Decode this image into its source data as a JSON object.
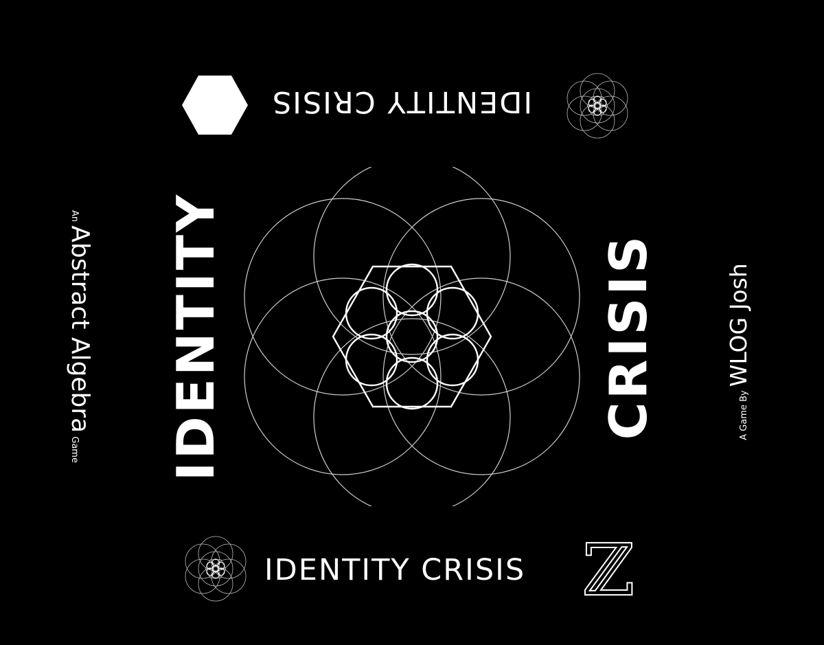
{
  "box": {
    "title_top": "IDENTITY CRISIS",
    "title_bottom": "IDENTITY CRISIS",
    "spine_left": "IDENTITY",
    "spine_right": "CRISIS",
    "subtitle": {
      "prefix": "An",
      "main": "Abstract Algebra",
      "suffix": "Game"
    },
    "author": {
      "prefix": "A Game By",
      "name": "WLOG Josh"
    },
    "logo_letter": "ℤ"
  },
  "colors": {
    "background": "#000000",
    "foreground": "#ffffff",
    "linework": "#cfcfcf"
  },
  "icons": [
    "hexagon-icon",
    "flower-of-life-icon",
    "integers-z-icon"
  ]
}
